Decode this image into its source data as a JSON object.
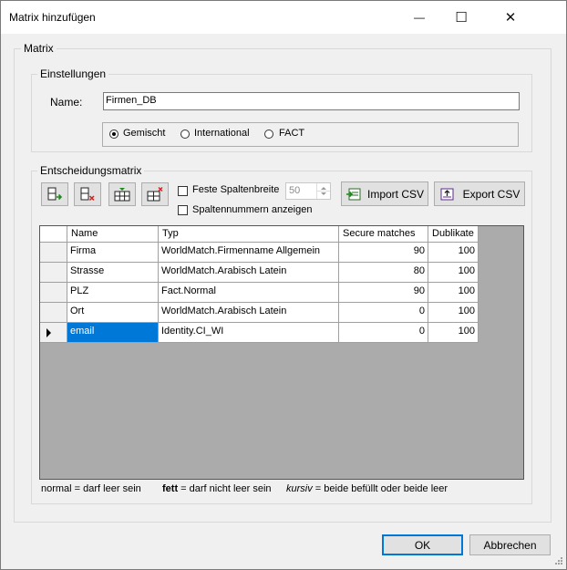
{
  "window": {
    "title": "Matrix hinzufügen"
  },
  "titlebar": {
    "minimize": "—",
    "maximize": "☐",
    "close": "✕"
  },
  "groups": {
    "matrix": "Matrix",
    "settings": "Einstellungen",
    "decision": "Entscheidungsmatrix"
  },
  "settings": {
    "name_label": "Name:",
    "name_value": "Firmen_DB",
    "radios": [
      {
        "label": "Gemischt",
        "checked": true
      },
      {
        "label": "International",
        "checked": false
      },
      {
        "label": "FACT",
        "checked": false
      }
    ]
  },
  "toolbar": {
    "icons": [
      "add-column-icon",
      "remove-column-icon",
      "add-row-icon",
      "remove-row-icon"
    ],
    "fixed_width_label": "Feste Spaltenbreite",
    "fixed_width_value": "50",
    "show_numbers_label": "Spaltennummern anzeigen",
    "import_label": "Import CSV",
    "export_label": "Export CSV"
  },
  "table": {
    "columns": [
      "Name",
      "Typ",
      "Secure matches",
      "Dublikate"
    ],
    "rows": [
      {
        "name": "Firma",
        "typ": "WorldMatch.Firmenname Allgemein",
        "secure": "90",
        "dub": "100"
      },
      {
        "name": "Strasse",
        "typ": "WorldMatch.Arabisch Latein",
        "secure": "80",
        "dub": "100"
      },
      {
        "name": "PLZ",
        "typ": "Fact.Normal",
        "secure": "90",
        "dub": "100"
      },
      {
        "name": "Ort",
        "typ": "WorldMatch.Arabisch Latein",
        "secure": "0",
        "dub": "100"
      },
      {
        "name": "email",
        "typ": "Identity.CI_WI",
        "secure": "0",
        "dub": "100"
      }
    ]
  },
  "legend": {
    "normal": "normal",
    "normal_rest": " = darf leer sein",
    "bold": "fett",
    "bold_rest": " = darf nicht leer sein",
    "italic": "kursiv",
    "italic_rest": " = beide befüllt oder beide leer"
  },
  "footer": {
    "ok": "OK",
    "cancel": "Abbrechen"
  }
}
